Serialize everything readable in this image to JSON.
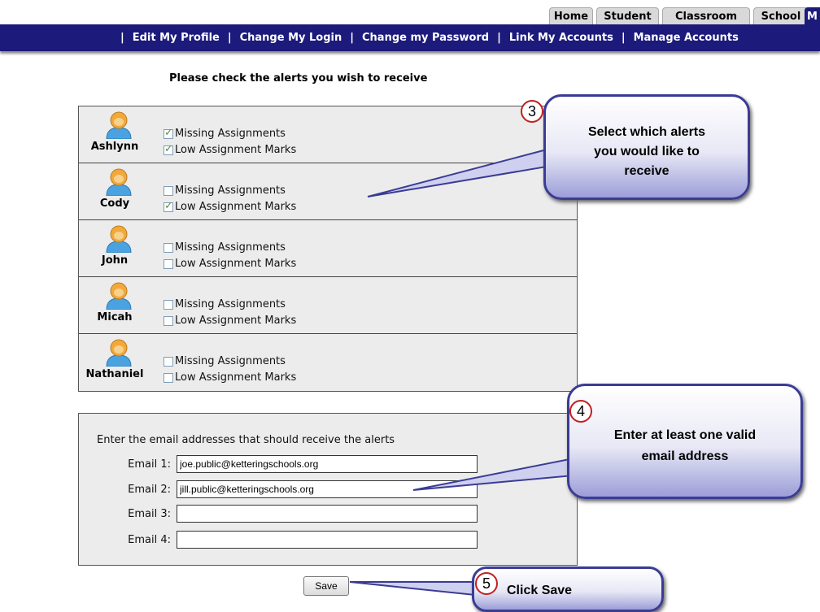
{
  "tabs": [
    "Home",
    "Student",
    "Classroom",
    "School",
    "M"
  ],
  "nav": {
    "separator": "|",
    "links": [
      "Edit My Profile",
      "Change My Login",
      "Change my Password",
      "Link My Accounts",
      "Manage Accounts"
    ]
  },
  "heading": "Please check the alerts you wish to receive",
  "students": [
    {
      "name": "Ashlynn",
      "missing_checked": true,
      "low_checked": true
    },
    {
      "name": "Cody",
      "missing_checked": false,
      "low_checked": true
    },
    {
      "name": "John",
      "missing_checked": false,
      "low_checked": false
    },
    {
      "name": "Micah",
      "missing_checked": false,
      "low_checked": false
    },
    {
      "name": "Nathaniel",
      "missing_checked": false,
      "low_checked": false
    }
  ],
  "alert_labels": {
    "missing": "Missing Assignments",
    "low": "Low Assignment Marks"
  },
  "email": {
    "heading": "Enter the email addresses that should receive the alerts",
    "fields": [
      {
        "label": "Email 1:",
        "value": "joe.public@ketteringschools.org"
      },
      {
        "label": "Email 2:",
        "value": "jill.public@ketteringschools.org"
      },
      {
        "label": "Email 3:",
        "value": ""
      },
      {
        "label": "Email 4:",
        "value": ""
      }
    ]
  },
  "save_label": "Save",
  "callouts": [
    {
      "number": "3",
      "text": "Select which alerts you would like to receive"
    },
    {
      "number": "4",
      "text": "Enter at least one valid email address"
    },
    {
      "number": "5",
      "text": "Click Save"
    }
  ],
  "colors": {
    "nav_bg": "#1c1a7a",
    "callout_border": "#3a3c94",
    "number_circle": "#c02020"
  }
}
